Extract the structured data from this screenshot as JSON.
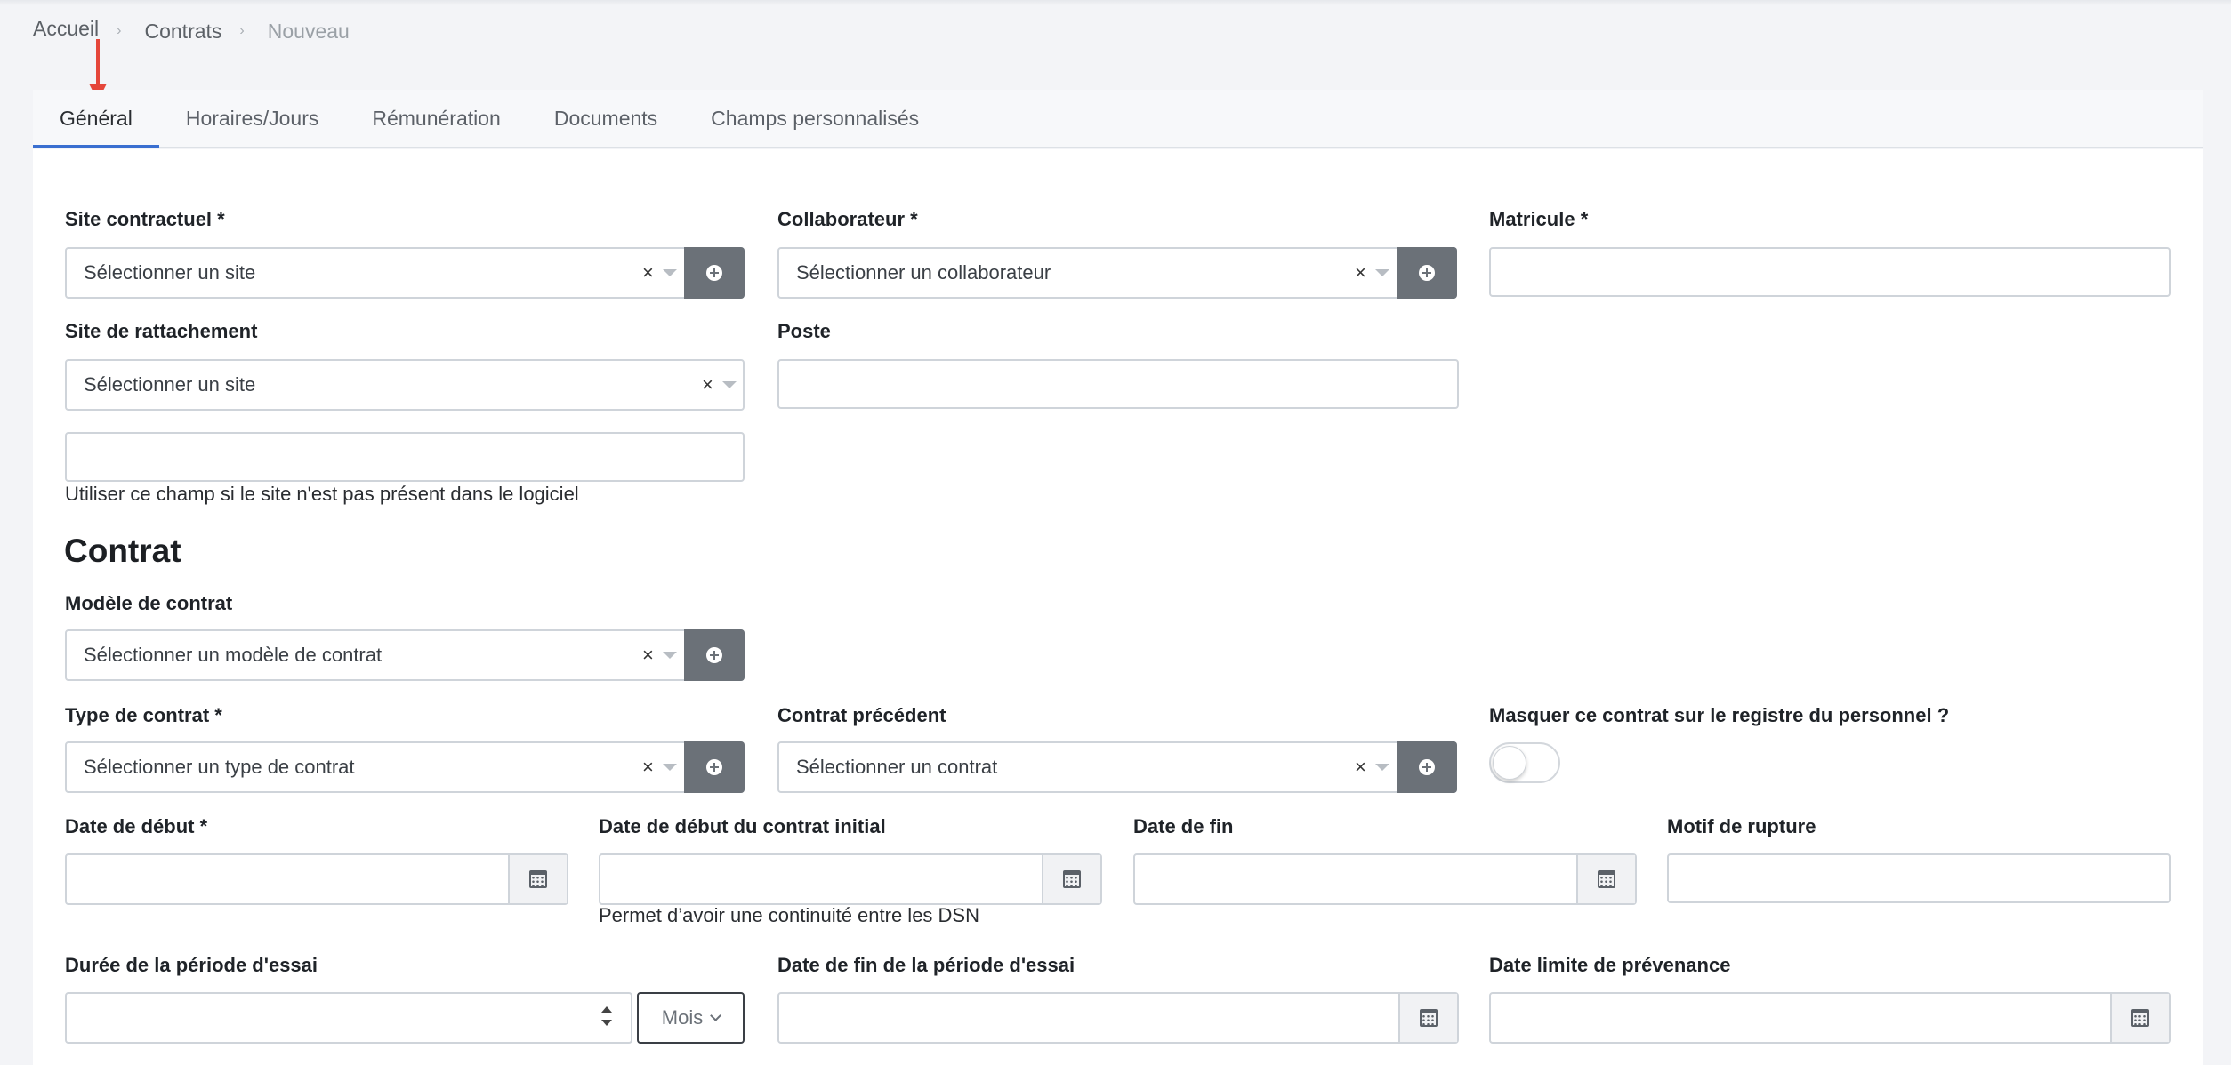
{
  "breadcrumb": {
    "home": "Accueil",
    "section": "Contrats",
    "current": "Nouveau"
  },
  "tabs": [
    {
      "label": "Général",
      "active": true
    },
    {
      "label": "Horaires/Jours"
    },
    {
      "label": "Rémunération"
    },
    {
      "label": "Documents"
    },
    {
      "label": "Champs personnalisés"
    }
  ],
  "general": {
    "site_contractuel": {
      "label": "Site contractuel *",
      "placeholder": "Sélectionner un site"
    },
    "collaborateur": {
      "label": "Collaborateur *",
      "placeholder": "Sélectionner un collaborateur"
    },
    "matricule": {
      "label": "Matricule *",
      "value": ""
    },
    "site_rattachement": {
      "label": "Site de rattachement",
      "placeholder": "Sélectionner un site"
    },
    "poste": {
      "label": "Poste",
      "value": ""
    },
    "site_libre": {
      "value": "",
      "help": "Utiliser ce champ si le site n'est pas présent dans le logiciel"
    }
  },
  "contrat": {
    "title": "Contrat",
    "modele": {
      "label": "Modèle de contrat",
      "placeholder": "Sélectionner un modèle de contrat"
    },
    "type": {
      "label": "Type de contrat *",
      "placeholder": "Sélectionner un type de contrat"
    },
    "precedent": {
      "label": "Contrat précédent",
      "placeholder": "Sélectionner un contrat"
    },
    "masquer": {
      "label": "Masquer ce contrat sur le registre du personnel ?",
      "on": false
    },
    "date_debut": {
      "label": "Date de début *",
      "value": ""
    },
    "date_debut_initial": {
      "label": "Date de début du contrat initial",
      "value": "",
      "help": "Permet d’avoir une continuité entre les DSN"
    },
    "date_fin": {
      "label": "Date de fin",
      "value": ""
    },
    "motif_rupture": {
      "label": "Motif de rupture",
      "value": ""
    },
    "duree_essai": {
      "label": "Durée de la période d'essai",
      "value": "",
      "unit": "Mois"
    },
    "date_fin_essai": {
      "label": "Date de fin de la période d'essai",
      "value": ""
    },
    "date_limite_prevenance": {
      "label": "Date limite de prévenance",
      "value": ""
    }
  },
  "icons": {
    "clear": "×",
    "add": "plus-circle-icon",
    "calendar": "calendar-icon",
    "dropdown": "caret-down-icon"
  },
  "colors": {
    "accent": "#3a6fd0",
    "add_button": "#6b7178",
    "annotation_arrow": "#e5463a"
  }
}
